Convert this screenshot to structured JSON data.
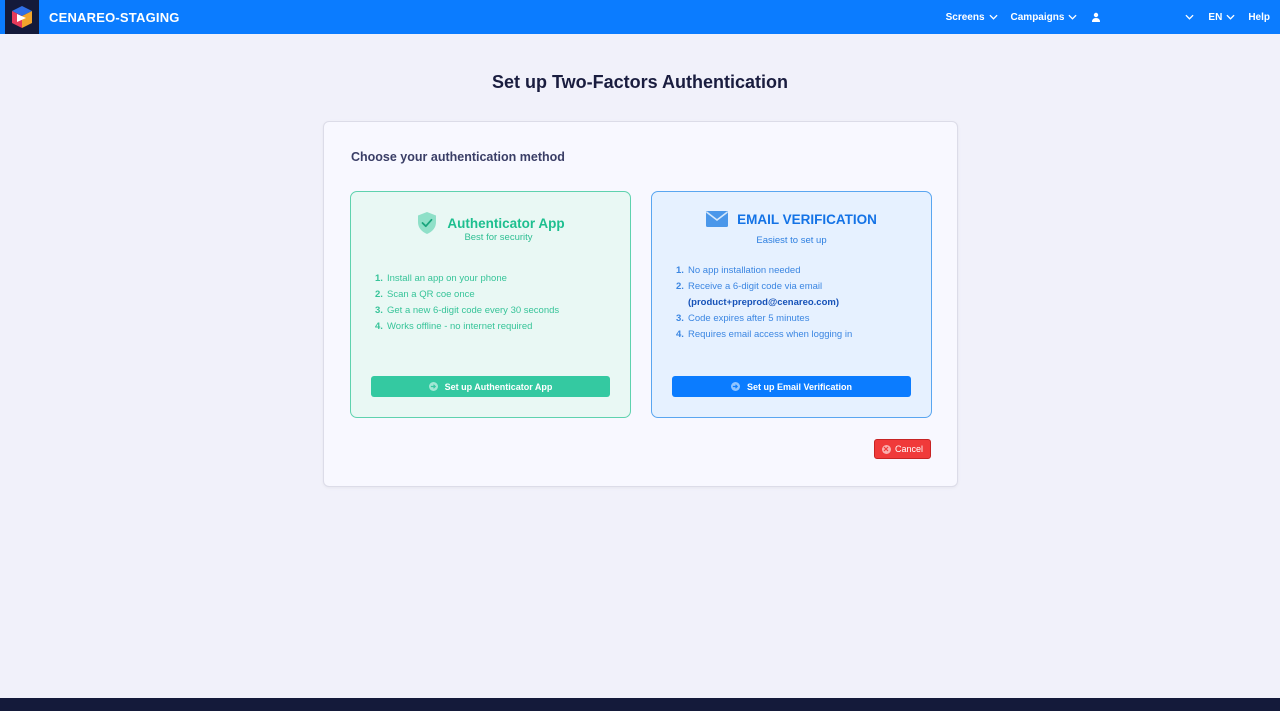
{
  "header": {
    "brand": "CENAREO-STAGING",
    "nav": {
      "screens": "Screens",
      "campaigns": "Campaigns",
      "language": "EN",
      "help": "Help"
    }
  },
  "page": {
    "title": "Set up Two-Factors Authentication"
  },
  "card": {
    "heading": "Choose your authentication method",
    "app_method": {
      "title": "Authenticator App",
      "subtitle": "Best for security",
      "steps": [
        {
          "num": "1.",
          "text": "Install an app on your phone"
        },
        {
          "num": "2.",
          "text": "Scan a QR coe once"
        },
        {
          "num": "3.",
          "text": "Get a new 6-digit code every 30 seconds"
        },
        {
          "num": "4.",
          "text": "Works offline - no internet required"
        }
      ],
      "button_label": "Set up Authenticator App"
    },
    "email_method": {
      "title": "EMAIL VERIFICATION",
      "subtitle": "Easiest to set up",
      "steps": [
        {
          "num": "1.",
          "text": "No app installation needed"
        },
        {
          "num": "2.",
          "text": "Receive a 6-digit code via email",
          "email": "(product+preprod@cenareo.com)"
        },
        {
          "num": "3.",
          "text": "Code expires after 5 minutes"
        },
        {
          "num": "4.",
          "text": "Requires email access when logging in"
        }
      ],
      "button_label": "Set up Email Verification"
    },
    "cancel_label": "Cancel"
  },
  "colors": {
    "primary": "#0b7cff",
    "app_accent": "#34c9a1",
    "danger": "#f03a3a",
    "dark": "#141a3a"
  }
}
